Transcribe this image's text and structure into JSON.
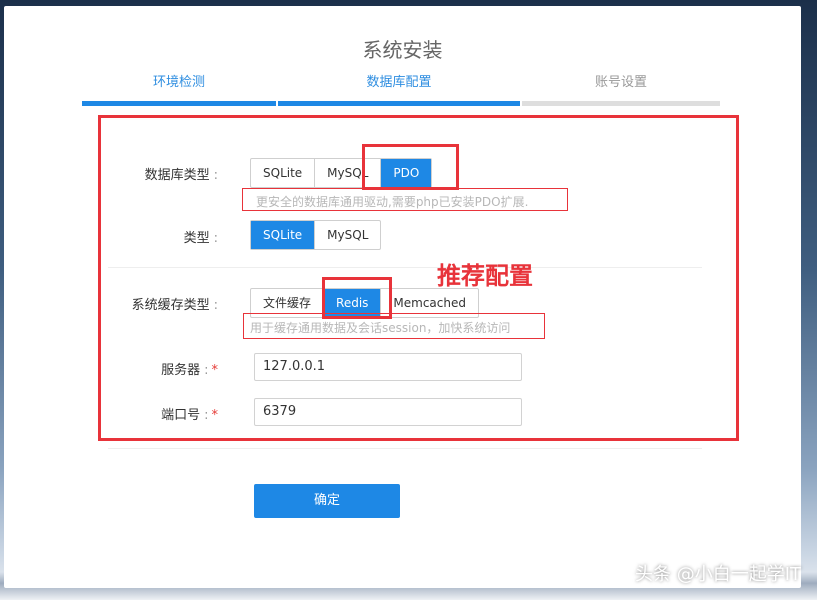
{
  "page": {
    "title": "系统安装"
  },
  "steps": [
    {
      "label": "环境检测",
      "state": "done"
    },
    {
      "label": "数据库配置",
      "state": "active"
    },
    {
      "label": "账号设置",
      "state": "pending"
    }
  ],
  "form": {
    "colon": ":",
    "required_mark": "*",
    "db_type": {
      "label": "数据库类型",
      "options": [
        "SQLite",
        "MySQL",
        "PDO"
      ],
      "selected": "PDO",
      "hint": "更安全的数据库通用驱动,需要php已安装PDO扩展."
    },
    "type": {
      "label": "类型",
      "options": [
        "SQLite",
        "MySQL"
      ],
      "selected": "SQLite"
    },
    "cache_type": {
      "label": "系统缓存类型",
      "options": [
        "文件缓存",
        "Redis",
        "Memcached"
      ],
      "selected": "Redis",
      "hint": "用于缓存通用数据及会话session，加快系统访问"
    },
    "server": {
      "label": "服务器",
      "value": "127.0.0.1"
    },
    "port": {
      "label": "端口号",
      "value": "6379"
    },
    "confirm_label": "确定"
  },
  "annotation": {
    "text": "推荐配置",
    "color": "#e8333a"
  },
  "watermark": "头条 @小白一起学IT",
  "colors": {
    "accent": "#1e88e5",
    "annotation": "#e8333a"
  }
}
